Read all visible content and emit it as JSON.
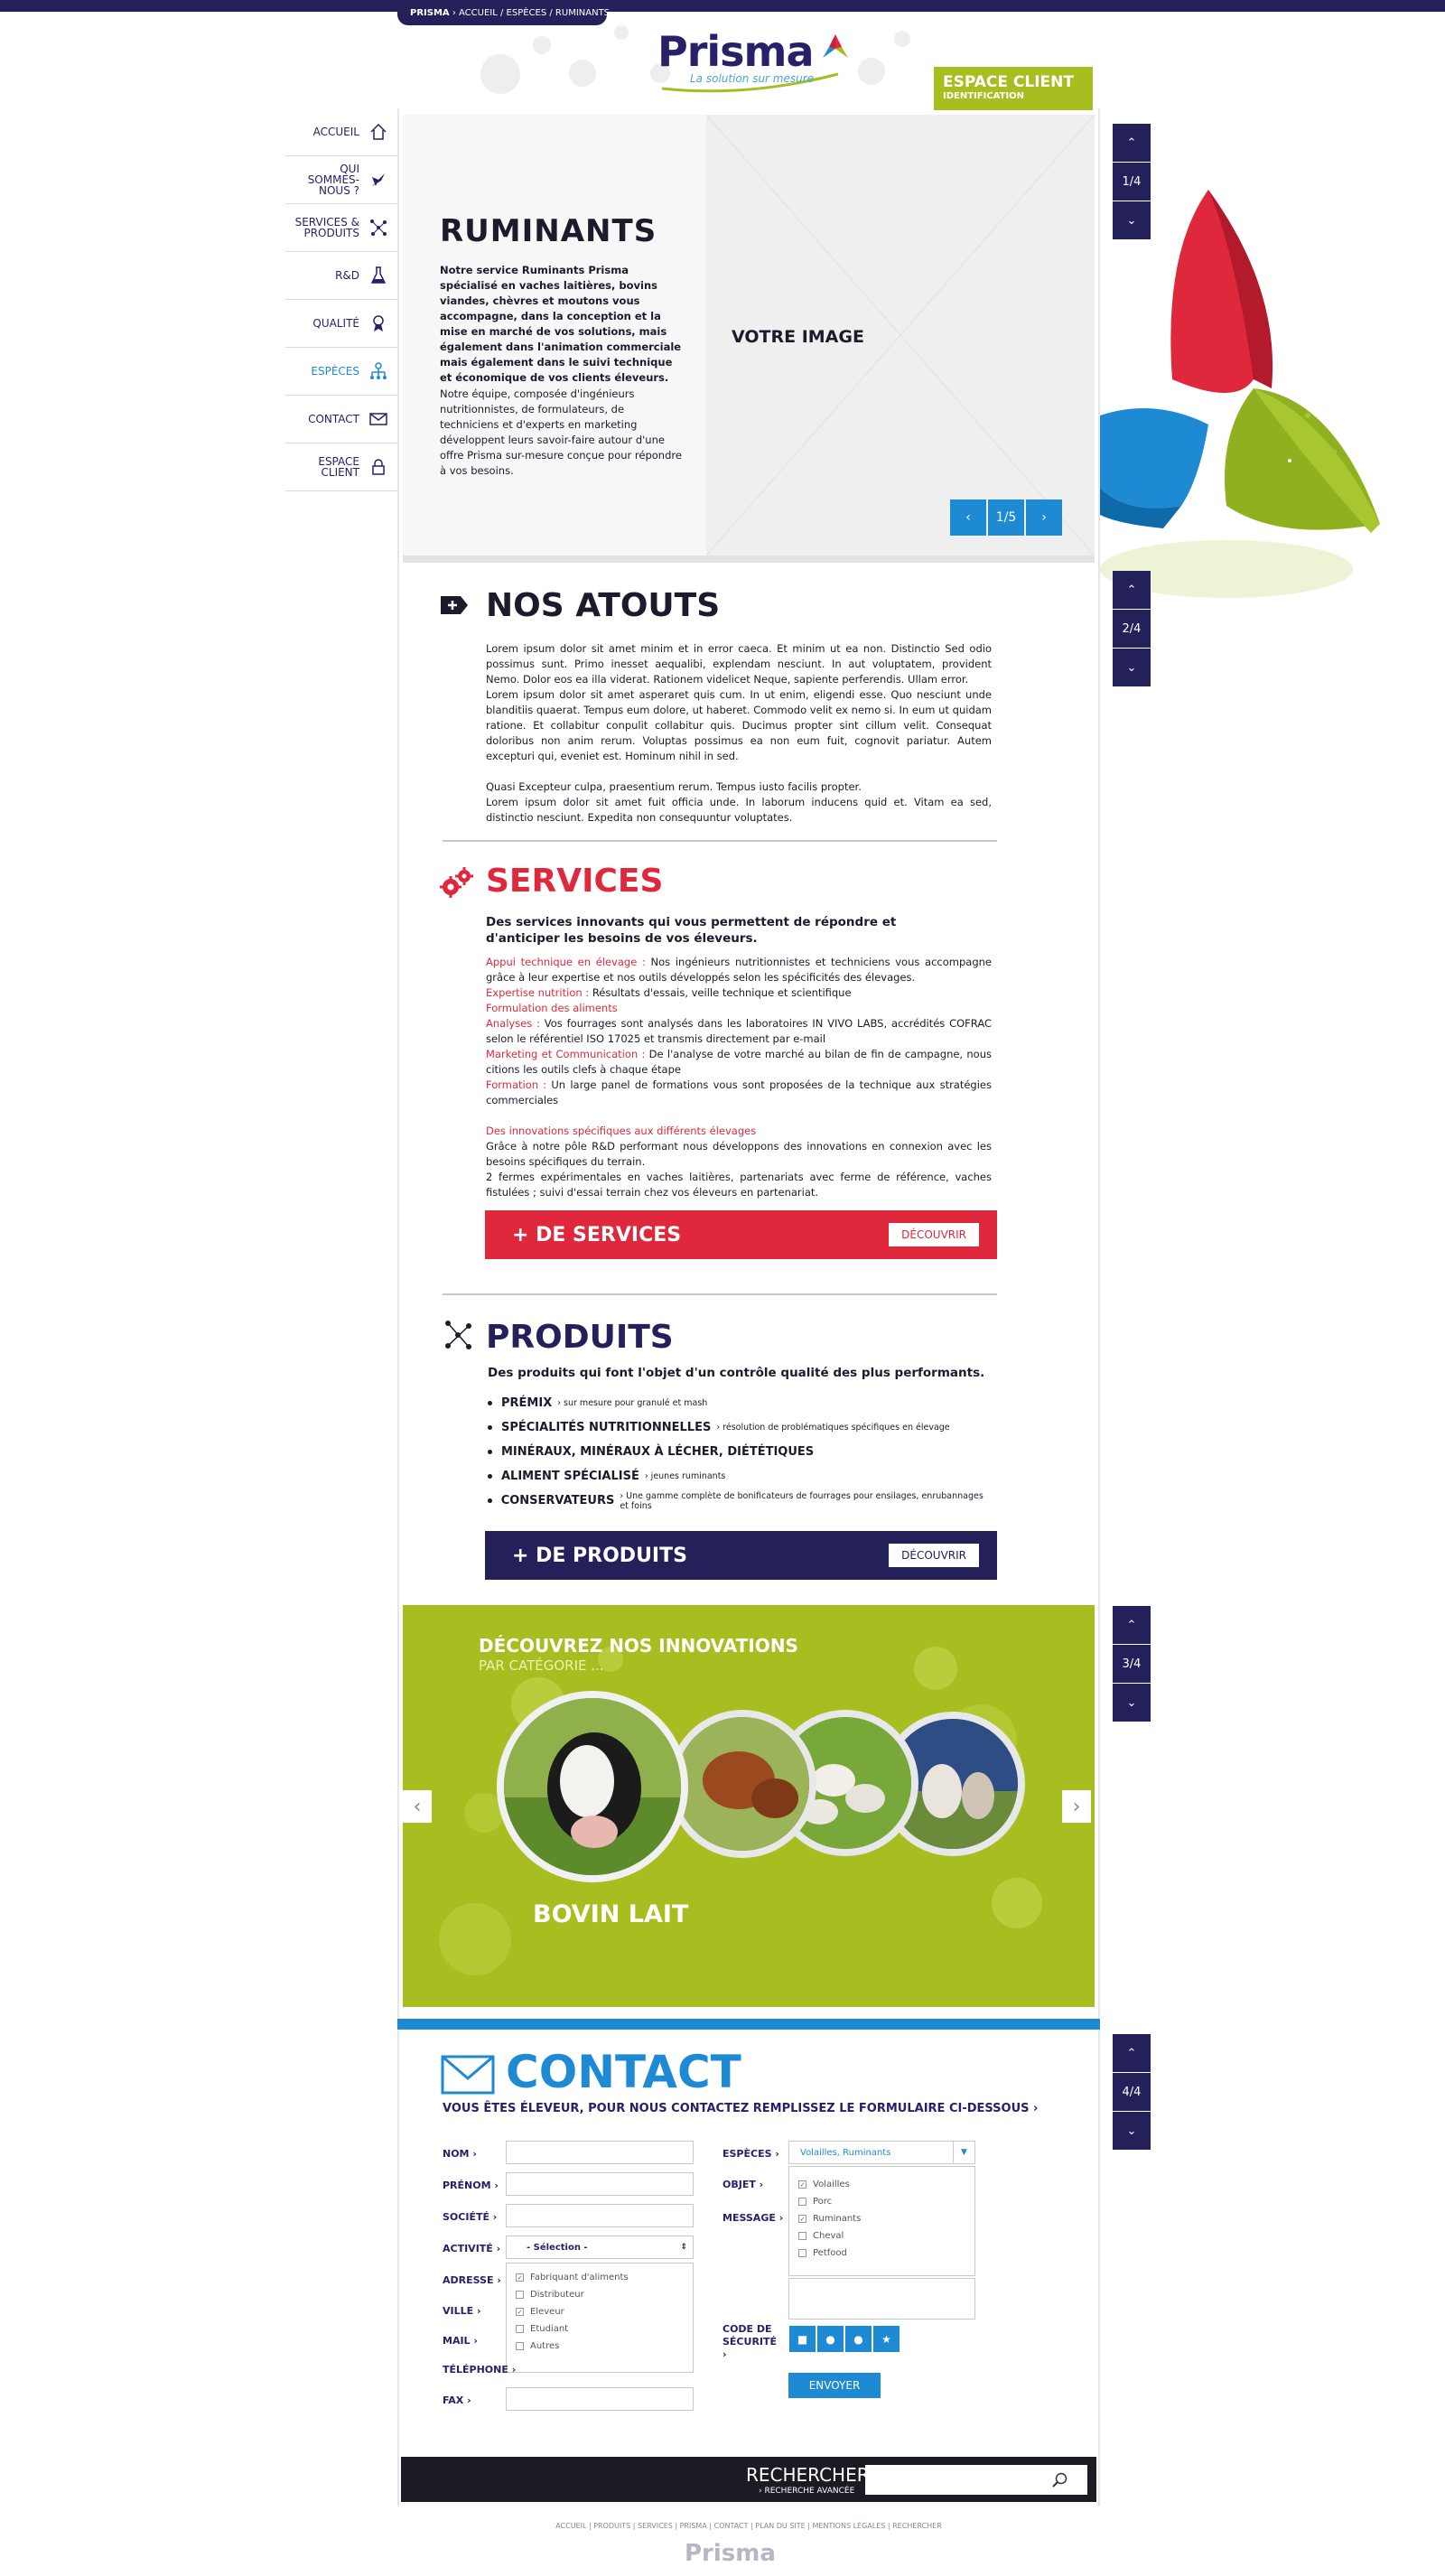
{
  "breadcrumb": {
    "root": "PRISMA",
    "sep": " › ",
    "path": "ACCUEIL / ESPÈCES / RUMINANTS"
  },
  "header": {
    "logo_text": "Prisma",
    "logo_tagline": "La solution sur mesure",
    "espace_client": "ESPACE CLIENT",
    "espace_sub": "IDENTIFICATION"
  },
  "nav": [
    {
      "label": "ACCUEIL",
      "icon": "home-icon"
    },
    {
      "label": "QUI SOMMES-NOUS ?",
      "icon": "molecule-icon"
    },
    {
      "label": "SERVICES & PRODUITS",
      "icon": "network-icon"
    },
    {
      "label": "R&D",
      "icon": "flask-icon"
    },
    {
      "label": "QUALITÉ",
      "icon": "medal-icon"
    },
    {
      "label": "ESPÈCES",
      "icon": "species-icon",
      "active": true
    },
    {
      "label": "CONTACT",
      "icon": "mail-icon"
    },
    {
      "label": "ESPACE CLIENT",
      "icon": "lock-icon"
    }
  ],
  "hero": {
    "title": "RUMINANTS",
    "p1": "Notre service Ruminants Prisma spécialisé en vaches laitières, bovins viandes, chèvres et moutons vous accompagne, dans la conception et la mise en marché de vos solutions, mais également dans l'animation commerciale mais également dans le suivi technique et économique de vos clients éleveurs.",
    "p2": "Notre équipe, composée d'ingénieurs nutritionnistes, de formulateurs, de techniciens et d'experts en marketing développent leurs savoir-faire autour d'une offre Prisma sur-mesure conçue pour répondre à vos besoins.",
    "image_label": "VOTRE IMAGE",
    "counter": "1/5"
  },
  "pagers": [
    "1/4",
    "2/4",
    "3/4",
    "4/4"
  ],
  "atouts": {
    "title": "NOS ATOUTS",
    "p1": "Lorem ipsum dolor sit amet minim et in error caeca. Et minim ut ea non. Distinctio Sed odio possimus sunt. Primo inesset aequalibi, explendam nesciunt. In aut voluptatem, provident Nemo. Dolor eos ea illa viderat. Rationem videlicet Neque, sapiente perferendis. Ullam error.",
    "p2": "Lorem ipsum dolor sit amet asperaret quis cum. In ut enim, eligendi esse. Quo nesciunt unde blanditiis quaerat. Tempus eum dolore, ut haberet. Commodo velit ex nemo si. In eum ut quidam ratione. Et collabitur conpulit collabitur quis. Ducimus propter sint cillum velit. Consequat doloribus non anim rerum. Voluptas possimus ea non eum fuit, cognovit pariatur. Autem excepturi qui, eveniet est. Hominum nihil in sed.",
    "p3": "Quasi Excepteur culpa, praesentium rerum. Tempus iusto facilis propter.",
    "p4": "Lorem ipsum dolor sit amet fuit officia unde. In laborum inducens quid et. Vitam ea sed, distinctio nesciunt. Expedita non consequuntur voluptates."
  },
  "services": {
    "title": "SERVICES",
    "lead": "Des services innovants qui vous permettent de répondre et d'anticiper les besoins de vos éleveurs.",
    "items": [
      {
        "k": "Appui technique en élevage :",
        "v": " Nos ingénieurs nutritionnistes et techniciens vous accompagne grâce à leur expertise et nos outils développés selon les spécificités des élevages."
      },
      {
        "k": "Expertise nutrition :",
        "v": " Résultats d'essais, veille technique et scientifique"
      },
      {
        "k": "Formulation des aliments",
        "v": ""
      },
      {
        "k": "Analyses :",
        "v": " Vos fourrages sont analysés dans les laboratoires IN VIVO LABS, accrédités COFRAC selon le référentiel ISO 17025 et transmis directement par e-mail"
      },
      {
        "k": "Marketing et Communication :",
        "v": " De l'analyse de votre marché au bilan de fin de campagne, nous citions les outils clefs à chaque étape"
      },
      {
        "k": "Formation :",
        "v": " Un large panel de formations vous sont proposées de la technique aux stratégies commerciales"
      }
    ],
    "innov_title": "Des innovations spécifiques aux différents élevages",
    "innov1": "Grâce à notre pôle R&D performant nous développons des innovations en connexion avec les besoins spécifiques du terrain.",
    "innov2": "2 fermes expérimentales en vaches laitières, partenariats avec ferme de référence, vaches fistulées ; suivi d'essai terrain chez vos éleveurs en partenariat.",
    "banner": "+ DE SERVICES",
    "button": "DÉCOUVRIR"
  },
  "produits": {
    "title": "PRODUITS",
    "lead": "Des produits qui font l'objet d'un contrôle qualité des plus performants.",
    "items": [
      {
        "k": "PRÉMIX",
        "v": "› sur mesure pour granulé et mash"
      },
      {
        "k": "SPÉCIALITÉS NUTRITIONNELLES",
        "v": "› résolution de problématiques spécifiques en élevage"
      },
      {
        "k": "MINÉRAUX, MINÉRAUX À LÉCHER, DIÉTÉTIQUES",
        "v": ""
      },
      {
        "k": "ALIMENT SPÉCIALISÉ",
        "v": "› jeunes ruminants"
      },
      {
        "k": "CONSERVATEURS",
        "v": "› Une gamme complète de bonificateurs de fourrages pour ensilages, enrubannages et foins"
      }
    ],
    "banner": "+ DE PRODUITS",
    "button": "DÉCOUVRIR"
  },
  "innovations": {
    "title": "DÉCOUVREZ NOS INNOVATIONS",
    "sub": "PAR CATÉGORIE ...",
    "caption": "BOVIN LAIT"
  },
  "contact": {
    "title": "CONTACT",
    "sub": "VOUS ÊTES ÉLEVEUR, POUR NOUS CONTACTEZ REMPLISSEZ LE FORMULAIRE CI-DESSOUS ›",
    "left_labels": [
      "NOM ›",
      "PRÉNOM ›",
      "SOCIÉTÉ ›",
      "ACTIVITÉ ›",
      "ADRESSE ›",
      "VILLE ›",
      "MAIL ›",
      "TÉLÉPHONE ›",
      "FAX ›"
    ],
    "activite_value": "- Sélection -",
    "activite_options": [
      {
        "label": "Fabriquant d'aliments",
        "checked": true
      },
      {
        "label": "Distributeur",
        "checked": false
      },
      {
        "label": "Eleveur",
        "checked": true
      },
      {
        "label": "Etudiant",
        "checked": false
      },
      {
        "label": "Autres",
        "checked": false
      }
    ],
    "especes_label": "ESPÈCES ›",
    "especes_value": "Volailles, Ruminants",
    "objet_label": "OBJET ›",
    "message_label": "MESSAGE ›",
    "especes_options": [
      {
        "label": "Volailles",
        "checked": true
      },
      {
        "label": "Porc",
        "checked": false
      },
      {
        "label": "Ruminants",
        "checked": true
      },
      {
        "label": "Cheval",
        "checked": false
      },
      {
        "label": "Petfood",
        "checked": false
      }
    ],
    "code_label": "CODE DE SÉCURITÉ ›",
    "submit": "ENVOYER"
  },
  "search": {
    "title": "RECHERCHER",
    "advanced": "› RECHERCHE AVANCÉE",
    "placeholder": ""
  },
  "footer": {
    "links": "ACCUEIL | PRODUITS | SERVICES | PRISMA | CONTACT | PLAN DU SITE | MENTIONS LÉGALES | RECHERCHER",
    "logo": "Prisma"
  },
  "colors": {
    "navy": "#24205a",
    "blue": "#1e8ad4",
    "red": "#e0283c",
    "green": "#a8bd20"
  }
}
